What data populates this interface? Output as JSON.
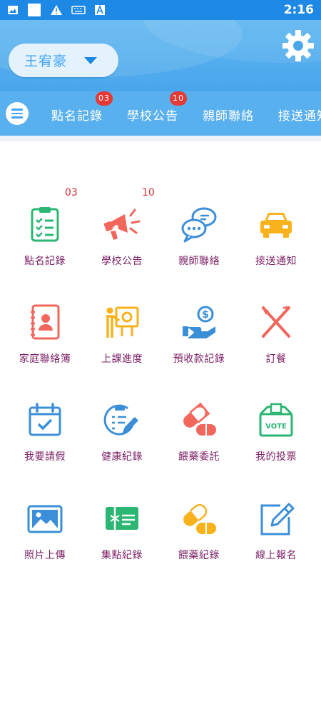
{
  "status_bar": {
    "time": "2:16"
  },
  "header": {
    "user_name": "王宥豪"
  },
  "tabs": [
    {
      "label": "點名記錄",
      "badge": "03"
    },
    {
      "label": "學校公告",
      "badge": "10"
    },
    {
      "label": "親師聯絡",
      "badge": ""
    },
    {
      "label": "接送通知",
      "badge": ""
    }
  ],
  "grid": [
    {
      "label": "點名記錄",
      "icon": "attendance-clipboard-icon",
      "count": "03"
    },
    {
      "label": "學校公告",
      "icon": "megaphone-icon",
      "count": "10"
    },
    {
      "label": "親師聯絡",
      "icon": "chat-bubbles-icon"
    },
    {
      "label": "接送通知",
      "icon": "car-icon"
    },
    {
      "label": "家庭聯絡簿",
      "icon": "contact-book-icon"
    },
    {
      "label": "上課進度",
      "icon": "teacher-board-icon"
    },
    {
      "label": "預收款記錄",
      "icon": "coin-hand-icon"
    },
    {
      "label": "訂餐",
      "icon": "fork-knife-icon"
    },
    {
      "label": "我要請假",
      "icon": "calendar-check-icon"
    },
    {
      "label": "健康紀錄",
      "icon": "health-clipboard-icon"
    },
    {
      "label": "餵藥委託",
      "icon": "capsule-red-icon"
    },
    {
      "label": "我的投票",
      "icon": "vote-box-icon"
    },
    {
      "label": "照片上傳",
      "icon": "photo-icon"
    },
    {
      "label": "集點紀錄",
      "icon": "gift-card-icon"
    },
    {
      "label": "餵藥紀錄",
      "icon": "capsule-yellow-icon"
    },
    {
      "label": "線上報名",
      "icon": "edit-form-icon"
    }
  ],
  "vote_box_text": "VOTE",
  "colors": {
    "accent": "#42a5f5",
    "label": "#7b1f63",
    "badge": "#e53935"
  }
}
